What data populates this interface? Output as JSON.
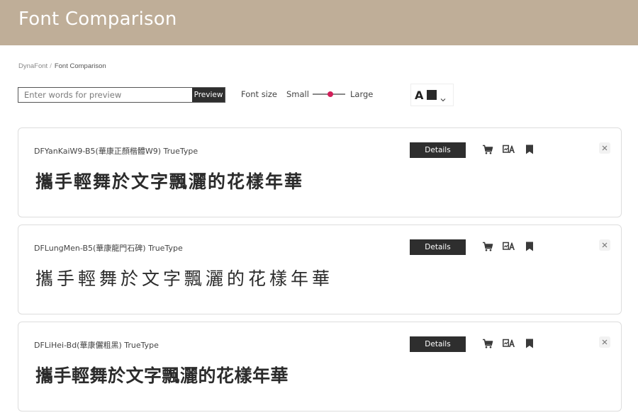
{
  "header": {
    "title": "Font Comparison"
  },
  "breadcrumb": {
    "root": "DynaFont",
    "separator": "/",
    "current": "Font Comparison"
  },
  "toolbar": {
    "search_placeholder": "Enter words for preview",
    "search_value": "",
    "preview_label": "Preview",
    "font_size_label": "Font size",
    "size_small_label": "Small",
    "size_large_label": "Large",
    "size_slider_fraction": 0.55,
    "slider_accent_color": "#d21f5a",
    "color_picker": {
      "letter": "A",
      "swatch_color": "#2a2a2a"
    }
  },
  "fonts": [
    {
      "name": "DFYanKaiW9-B5(華康正顏楷體W9) TrueType",
      "sample": "攜手輕舞於文字飄灑的花樣年華",
      "details_label": "Details"
    },
    {
      "name": "DFLungMen-B5(華康龍門石碑) TrueType",
      "sample": "攜手輕舞於文字飄灑的花樣年華",
      "details_label": "Details"
    },
    {
      "name": "DFLiHei-Bd(華康儷粗黑) TrueType",
      "sample": "攜手輕舞於文字飄灑的花樣年華",
      "details_label": "Details"
    }
  ],
  "colors": {
    "header_bg": "#bfae98",
    "button_bg": "#2e2e2e",
    "icon_color": "#3a3a3a"
  },
  "icons": [
    "cart-icon",
    "compare-icon",
    "bookmark-icon",
    "close-icon",
    "chevron-down-icon"
  ]
}
